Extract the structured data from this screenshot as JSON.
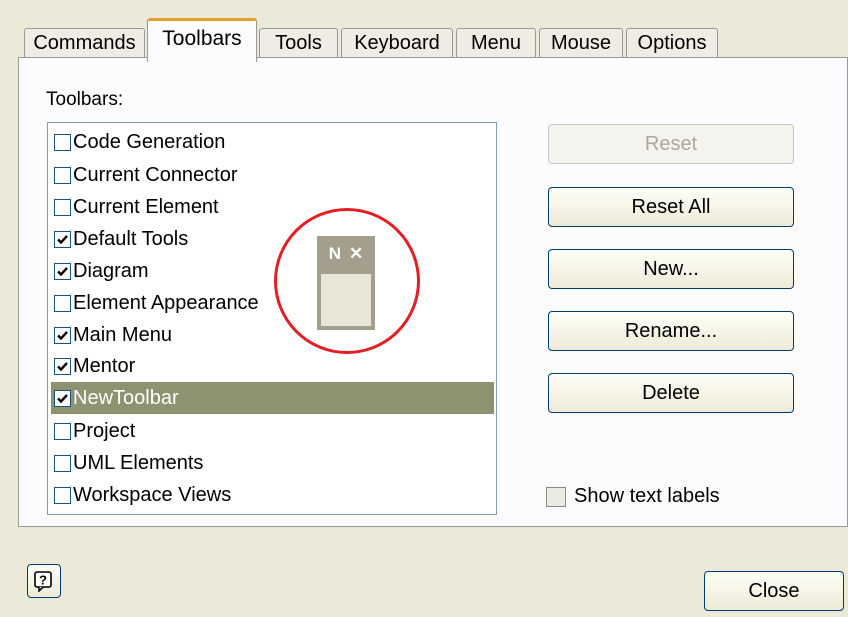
{
  "tabs": [
    "Commands",
    "Toolbars",
    "Tools",
    "Keyboard",
    "Menu",
    "Mouse",
    "Options"
  ],
  "active_tab": "Toolbars",
  "toolbars_label": "Toolbars:",
  "toolbars_list": [
    {
      "label": "Code Generation",
      "checked": false,
      "selected": false
    },
    {
      "label": "Current Connector",
      "checked": false,
      "selected": false
    },
    {
      "label": "Current Element",
      "checked": false,
      "selected": false
    },
    {
      "label": "Default Tools",
      "checked": true,
      "selected": false
    },
    {
      "label": "Diagram",
      "checked": true,
      "selected": false
    },
    {
      "label": "Element Appearance",
      "checked": false,
      "selected": false
    },
    {
      "label": "Main Menu",
      "checked": true,
      "selected": false
    },
    {
      "label": "Mentor",
      "checked": true,
      "selected": false
    },
    {
      "label": "NewToolbar",
      "checked": true,
      "selected": true
    },
    {
      "label": "Project",
      "checked": false,
      "selected": false
    },
    {
      "label": "UML Elements",
      "checked": false,
      "selected": false
    },
    {
      "label": "Workspace Views",
      "checked": false,
      "selected": false
    }
  ],
  "floating_toolbar": {
    "title_chars": "N",
    "close_char": "✕"
  },
  "buttons": {
    "reset": "Reset",
    "reset_all": "Reset All",
    "new": "New...",
    "rename": "Rename...",
    "delete": "Delete"
  },
  "show_text_labels": {
    "label": "Show text labels",
    "checked": false
  },
  "help_glyph": "?",
  "close_label": "Close",
  "colors": {
    "selection": "#8D9271",
    "annotation": "#E31E24",
    "active_tab_accent": "#E0A02C"
  }
}
